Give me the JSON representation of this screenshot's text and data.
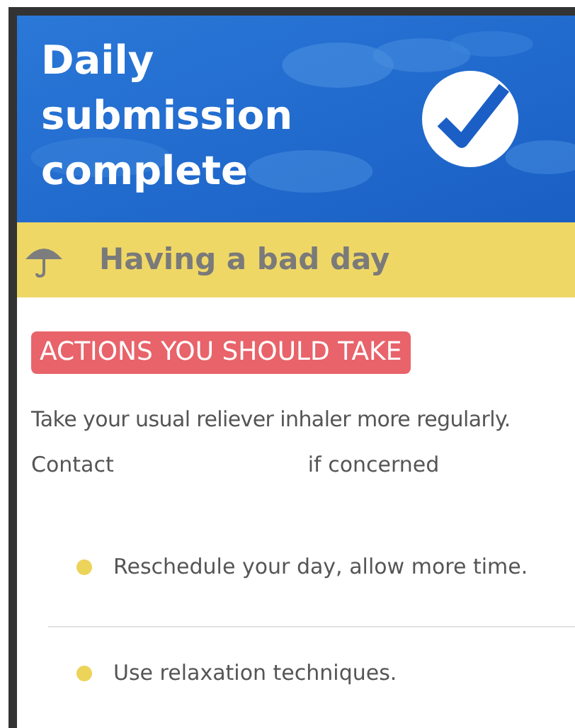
{
  "header": {
    "title": "Daily submission complete"
  },
  "status_banner": {
    "label": "Having a bad day"
  },
  "actions": {
    "heading": "ACTIONS YOU SHOULD TAKE",
    "instruction": "Take your usual reliever inhaler more regularly.",
    "contact_prefix": "Contact",
    "contact_suffix": "if concerned",
    "tips": [
      {
        "text": "Reschedule your day, allow more time.",
        "color": "#ecd35a"
      },
      {
        "text": "Use relaxation techniques.",
        "color": "#ecd35a"
      }
    ]
  }
}
